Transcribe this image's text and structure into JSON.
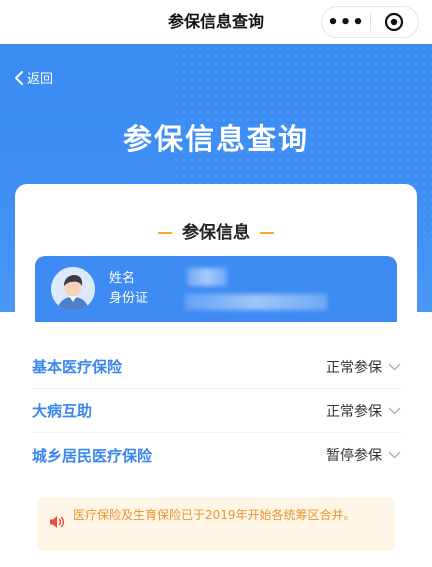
{
  "navbar": {
    "title": "参保信息查询",
    "more_icon": "more-dots-icon",
    "close_icon": "target-close-icon"
  },
  "header": {
    "back_label": "返回",
    "title": "参保信息查询",
    "background_color": "#3f8ff5"
  },
  "card": {
    "section_title": "参保信息",
    "person": {
      "name_label": "姓名",
      "id_label": "身份证"
    }
  },
  "insurance_list": [
    {
      "name": "基本医疗保险",
      "status": "正常参保"
    },
    {
      "name": "大病互助",
      "status": "正常参保"
    },
    {
      "name": "城乡居民医疗保险",
      "status": "暂停参保"
    }
  ],
  "notice": {
    "icon": "speaker-icon",
    "text": "医疗保险及生育保险已于2019年开始各统筹区合并。"
  },
  "colors": {
    "accent": "#3a86f0",
    "notice_text": "#e9952f",
    "notice_bg": "#fff6e8",
    "title_dash": "#ffa534"
  }
}
